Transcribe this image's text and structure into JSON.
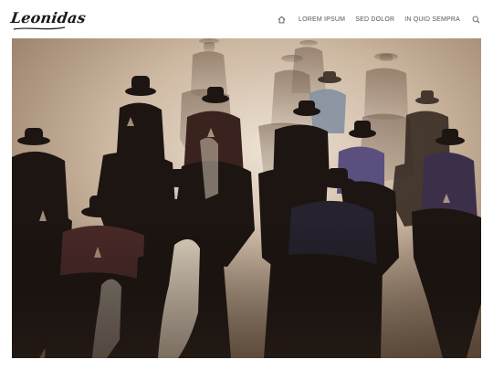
{
  "header": {
    "logo_text": "Leonidas",
    "nav": {
      "home_icon": "home-icon",
      "items": [
        {
          "label": "LOREM IPSUM"
        },
        {
          "label": "SED DOLOR"
        },
        {
          "label": "IN QUID SEMPRA"
        }
      ],
      "search_icon": "search-icon"
    }
  },
  "hero": {
    "image_description_icon": "cowboys-on-horseback-photo",
    "colors": {
      "dust_light": "#e9dccd",
      "dust_mid": "#c9b39b",
      "dust_warm": "#a8896c",
      "silhouette": "#1b1512",
      "rim_light": "#f3e3cc"
    }
  }
}
